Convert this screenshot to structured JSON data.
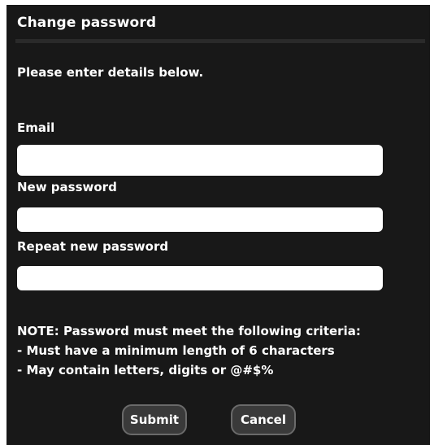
{
  "dialog": {
    "title": "Change password",
    "intro": "Please enter details below.",
    "fields": {
      "email_label": "Email",
      "email_value": "",
      "new_password_label": "New password",
      "new_password_value": "",
      "repeat_password_label": "Repeat new password",
      "repeat_password_value": ""
    },
    "note": {
      "line1": "NOTE: Password must meet the following criteria:",
      "line2": "- Must have a minimum length of 6 characters",
      "line3": "- May contain letters, digits or @#$%"
    },
    "buttons": {
      "submit": "Submit",
      "cancel": "Cancel"
    }
  }
}
